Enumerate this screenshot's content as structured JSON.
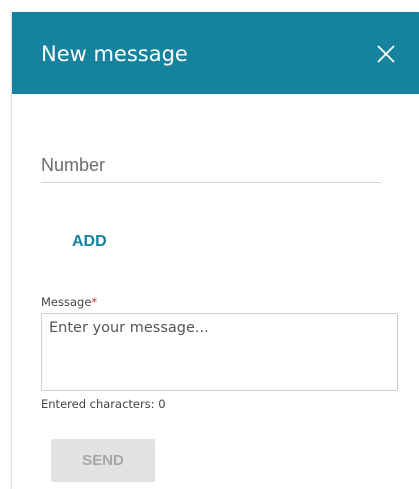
{
  "dialog": {
    "title": "New message",
    "close_icon": "close-icon",
    "header_color": "#15839e"
  },
  "form": {
    "number_placeholder": "Number",
    "number_value": "",
    "add_label": "ADD",
    "message_label": "Message",
    "message_required_mark": "*",
    "message_placeholder": "Enter your message...",
    "message_value": "",
    "counter_text": "Entered characters: 0",
    "send_label": "SEND"
  }
}
